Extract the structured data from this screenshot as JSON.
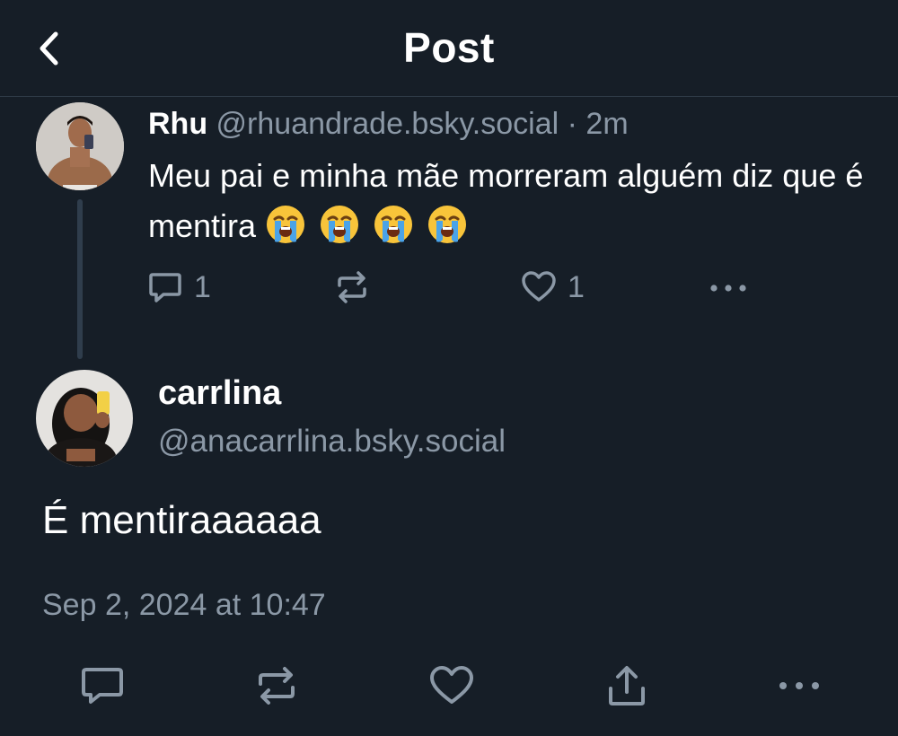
{
  "header": {
    "title": "Post",
    "back_icon": "chevron-left-icon"
  },
  "parent_post": {
    "author_name": "Rhu",
    "handle": "@rhuandrade.bsky.social",
    "separator": "·",
    "time_ago": "2m",
    "text": "Meu pai e minha mãe morreram alguém diz que é mentira",
    "emojis": [
      "loudly-crying-face",
      "loudly-crying-face",
      "loudly-crying-face",
      "loudly-crying-face"
    ],
    "reply_count": "1",
    "like_count": "1"
  },
  "reply_post": {
    "author_name": "carrlina",
    "handle": "@anacarrlina.bsky.social",
    "text": "É mentiraaaaaa",
    "timestamp": "Sep 2, 2024 at 10:47"
  },
  "colors": {
    "background": "#161e27",
    "muted": "#8b98a6",
    "thread_line": "#2f3d4c",
    "emoji": "#f8c43a",
    "tear": "#4aa3e8"
  }
}
